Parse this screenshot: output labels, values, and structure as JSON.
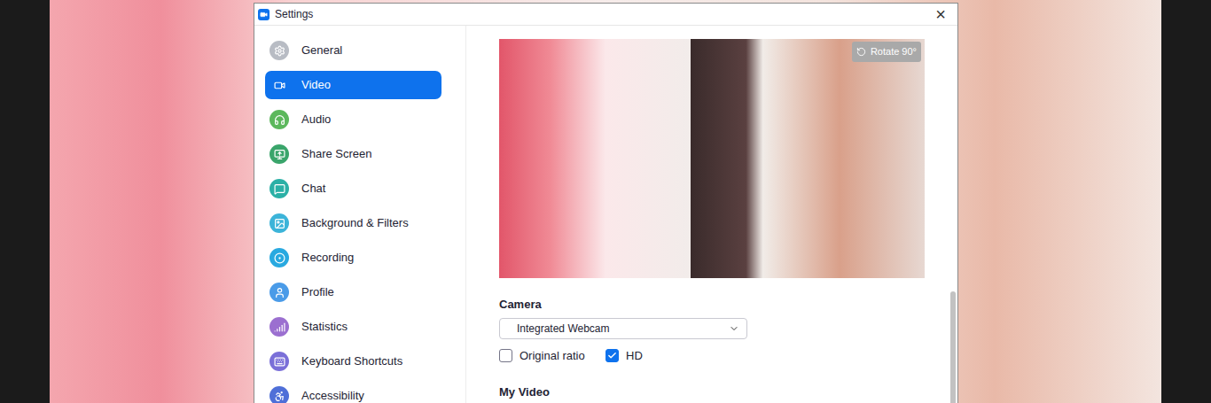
{
  "window": {
    "title": "Settings",
    "close": "×"
  },
  "sidebar": {
    "items": [
      {
        "label": "General",
        "selected": false,
        "color": "#b8bcc4"
      },
      {
        "label": "Video",
        "selected": true,
        "color": "#0e72ed"
      },
      {
        "label": "Audio",
        "selected": false,
        "color": "#5cb85c"
      },
      {
        "label": "Share Screen",
        "selected": false,
        "color": "#3aa56b"
      },
      {
        "label": "Chat",
        "selected": false,
        "color": "#2bb0a6"
      },
      {
        "label": "Background & Filters",
        "selected": false,
        "color": "#3cb4d9"
      },
      {
        "label": "Recording",
        "selected": false,
        "color": "#29a9e0"
      },
      {
        "label": "Profile",
        "selected": false,
        "color": "#4a9be8"
      },
      {
        "label": "Statistics",
        "selected": false,
        "color": "#9b6fd0"
      },
      {
        "label": "Keyboard Shortcuts",
        "selected": false,
        "color": "#7a6fd8"
      },
      {
        "label": "Accessibility",
        "selected": false,
        "color": "#4f6fd8"
      }
    ]
  },
  "preview": {
    "rotate_button": "Rotate 90°"
  },
  "camera": {
    "label": "Camera",
    "value": "Integrated Webcam"
  },
  "options": [
    {
      "label": "Original ratio",
      "checked": false
    },
    {
      "label": "HD",
      "checked": true
    }
  ],
  "my_video": {
    "label": "My Video",
    "options": [
      {
        "checked": true
      }
    ]
  }
}
